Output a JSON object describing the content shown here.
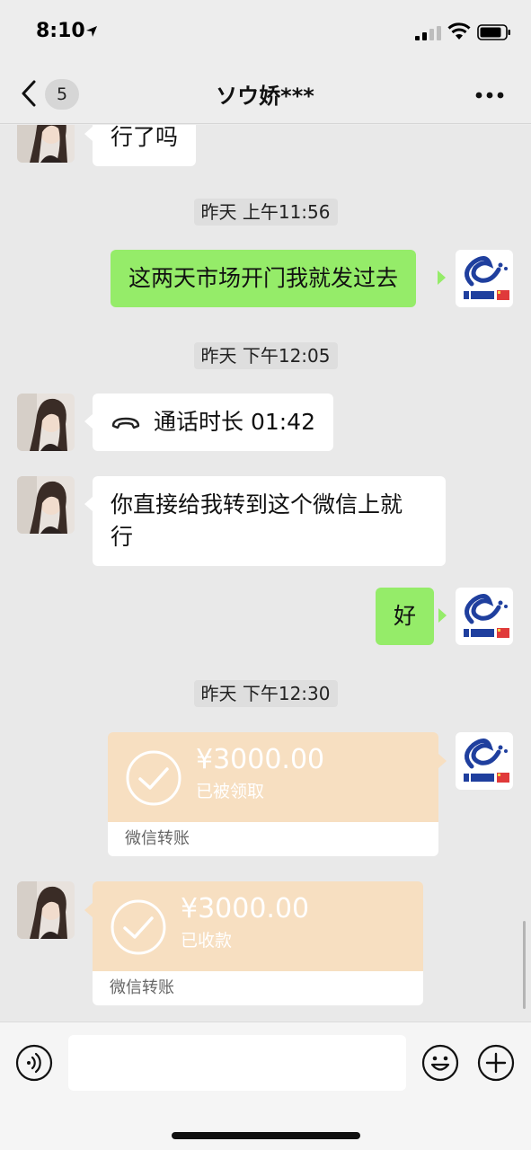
{
  "status_bar": {
    "time": "8:10"
  },
  "nav": {
    "unread_count": "5",
    "title": "ソウ娇***"
  },
  "messages": [
    {
      "side": "left",
      "text": "行了吗"
    },
    {
      "timestamp": "昨天 上午11:56"
    },
    {
      "side": "right",
      "text": "这两天市场开门我就发过去"
    },
    {
      "timestamp": "昨天 下午12:05"
    },
    {
      "side": "left",
      "call_label": "通话时长 01:42"
    },
    {
      "side": "left",
      "line1": "你直接给我转到这个微信上就",
      "line2": "行"
    },
    {
      "side": "right",
      "text": "好"
    },
    {
      "timestamp": "昨天 下午12:30"
    },
    {
      "side": "right",
      "amount": "¥3000.00",
      "status": "已被领取",
      "footer": "微信转账"
    },
    {
      "side": "left",
      "amount": "¥3000.00",
      "status": "已收款",
      "footer": "微信转账"
    }
  ],
  "colors": {
    "sent_bubble": "#95ec69",
    "received_bubble": "#ffffff",
    "transfer_card": "#f7dfc1",
    "chat_background": "#e9e9e9"
  },
  "icons": {
    "back": "chevron-left-icon",
    "more": "more-dots-icon",
    "call": "phone-handset-icon",
    "transfer_status": "check-circle-icon",
    "voice": "voice-icon",
    "emoji": "emoji-icon",
    "plus": "plus-icon"
  }
}
